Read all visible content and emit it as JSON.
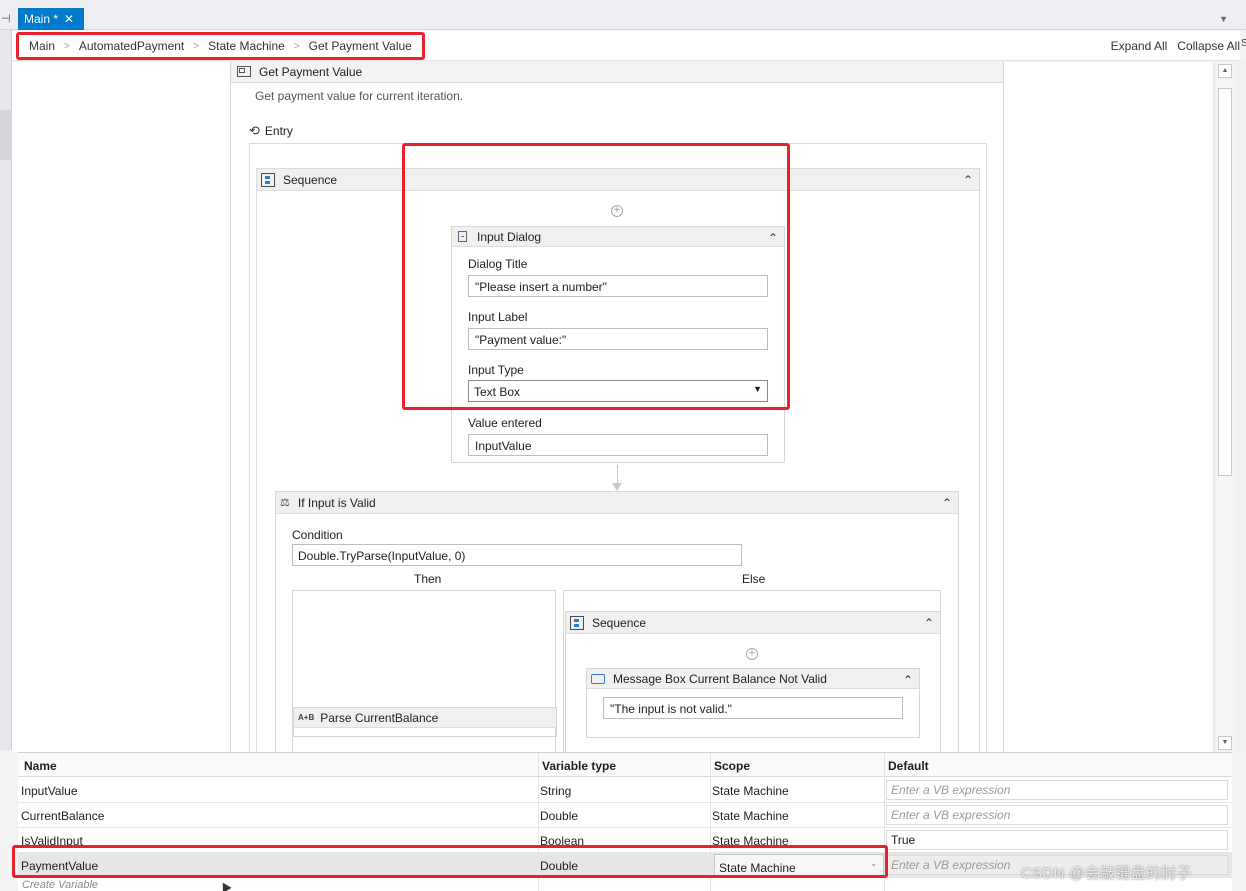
{
  "tab": {
    "title": "Main *",
    "close_glyph": "✕"
  },
  "breadcrumb": [
    "Main",
    "AutomatedPayment",
    "State Machine",
    "Get Payment Value"
  ],
  "toolbar": {
    "expand_all": "Expand All",
    "collapse_all": "Collapse All"
  },
  "state": {
    "title": "Get Payment Value",
    "description": "Get payment value for current iteration.",
    "entry_label": "Entry"
  },
  "sequence_outer": {
    "title": "Sequence"
  },
  "input_dialog": {
    "title": "Input Dialog",
    "dialog_title_label": "Dialog Title",
    "dialog_title_value": "\"Please insert a number\"",
    "input_label_label": "Input Label",
    "input_label_value": "\"Payment value:\"",
    "input_type_label": "Input Type",
    "input_type_value": "Text Box",
    "value_entered_label": "Value entered",
    "value_entered_value": "InputValue"
  },
  "if_activity": {
    "title": "If Input is Valid",
    "condition_label": "Condition",
    "condition_value": "Double.TryParse(InputValue, 0)",
    "then_label": "Then",
    "else_label": "Else",
    "parse_title": "Parse CurrentBalance",
    "else_sequence_title": "Sequence",
    "message_box_title": "Message Box Current Balance Not Valid",
    "message_box_value": "\"The input is not valid.\""
  },
  "variables": {
    "headers": {
      "name": "Name",
      "type": "Variable type",
      "scope": "Scope",
      "default": "Default"
    },
    "rows": [
      {
        "name": "InputValue",
        "type": "String",
        "scope": "State Machine",
        "default": "Enter a VB expression"
      },
      {
        "name": "CurrentBalance",
        "type": "Double",
        "scope": "State Machine",
        "default": "Enter a VB expression"
      },
      {
        "name": "IsValidInput",
        "type": "Boolean",
        "scope": "State Machine",
        "default": "True"
      },
      {
        "name": "PaymentValue",
        "type": "Double",
        "scope": "State Machine",
        "default": "Enter a VB expression"
      }
    ],
    "create_variable": "Create Variable"
  },
  "watermark": "CSDN @会敲键盘的肘子",
  "colors": {
    "accent": "#007acc",
    "highlight": "#e8212b"
  }
}
